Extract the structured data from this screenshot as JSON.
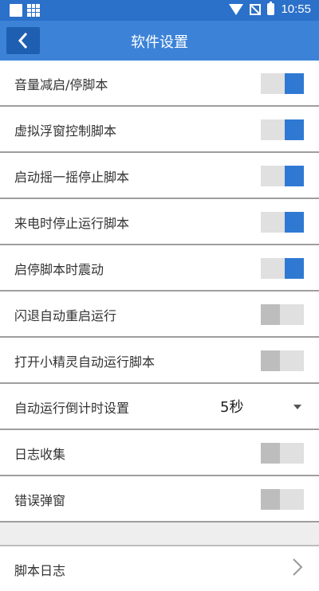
{
  "status_bar": {
    "time": "10:55"
  },
  "app_bar": {
    "title": "软件设置"
  },
  "settings": [
    {
      "id": "volume-down-script",
      "label": "音量减启/停脚本",
      "enabled": true
    },
    {
      "id": "floating-window-control",
      "label": "虚拟浮窗控制脚本",
      "enabled": true
    },
    {
      "id": "shake-stop",
      "label": "启动摇一摇停止脚本",
      "enabled": true
    },
    {
      "id": "call-stop",
      "label": "来电时停止运行脚本",
      "enabled": true
    },
    {
      "id": "vibrate",
      "label": "启停脚本时震动",
      "enabled": true
    },
    {
      "id": "crash-restart",
      "label": "闪退自动重启运行",
      "enabled": false
    },
    {
      "id": "sprite-auto-run",
      "label": "打开小精灵自动运行脚本",
      "enabled": false
    }
  ],
  "countdown": {
    "label": "自动运行倒计时设置",
    "value": "5秒"
  },
  "settings2": [
    {
      "id": "log-collection",
      "label": "日志收集",
      "enabled": false
    },
    {
      "id": "error-popup",
      "label": "错误弹窗",
      "enabled": false
    }
  ],
  "script_log": {
    "label": "脚本日志"
  }
}
